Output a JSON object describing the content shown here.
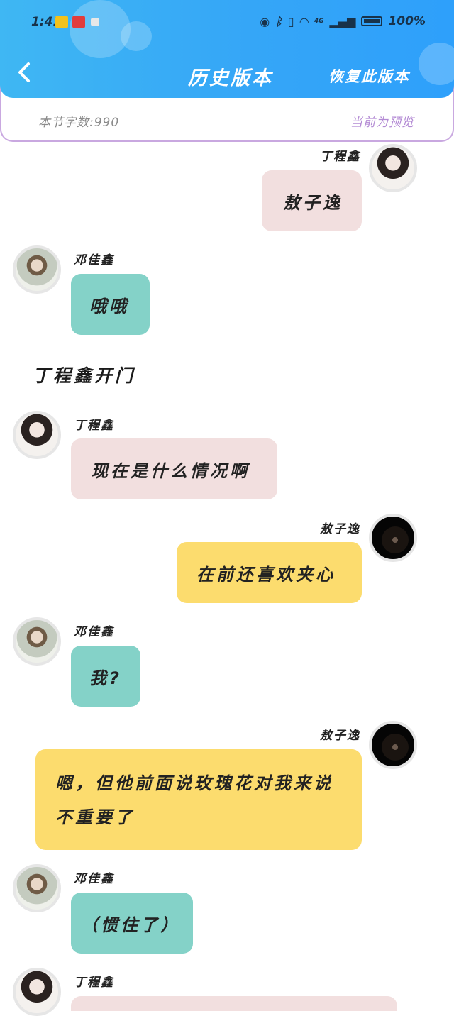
{
  "status_bar": {
    "time": "1:41",
    "battery": "100%",
    "network": "4G"
  },
  "header": {
    "title": "历史版本",
    "restore_label": "恢复此版本"
  },
  "info": {
    "word_count": "本节字数:990",
    "current": "当前为预览"
  },
  "chat": {
    "m1": {
      "name": "丁程鑫",
      "text": "敖子逸"
    },
    "m2": {
      "name": "邓佳鑫",
      "text": "哦哦"
    },
    "narration": "丁程鑫开门",
    "m3": {
      "name": "丁程鑫",
      "text": "现在是什么情况啊"
    },
    "m4": {
      "name": "敖子逸",
      "text": "在前还喜欢夹心"
    },
    "m5": {
      "name": "邓佳鑫",
      "text": "我?"
    },
    "m6": {
      "name": "敖子逸",
      "text": "嗯，但他前面说玫瑰花对我来说不重要了"
    },
    "m7": {
      "name": "邓佳鑫",
      "text": "（惯住了）"
    },
    "m8": {
      "name": "丁程鑫",
      "text": ""
    }
  },
  "colors": {
    "header": "#35a6f7",
    "pink_bubble": "#f2dfdf",
    "teal_bubble": "#84d2c8",
    "yellow_bubble": "#fcdc6e",
    "accent_purple": "#b38ad4"
  }
}
